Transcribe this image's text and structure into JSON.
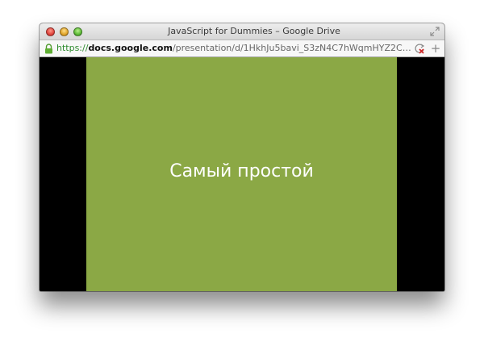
{
  "window": {
    "title": "JavaScript for Dummies – Google Drive"
  },
  "addressbar": {
    "url_scheme": "https://",
    "url_host": "docs.google.com",
    "url_path": "/presentation/d/1HkhJu5bavi_S3zN4C7hWqmHYZ2C…"
  },
  "slide": {
    "title": "Самый простой",
    "background_color": "#8ba845",
    "text_color": "#ffffff"
  },
  "icons": {
    "lock": "lock-icon",
    "reload": "reload-icon",
    "new_tab": "plus-icon",
    "fullscreen": "fullscreen-icon"
  },
  "new_tab_glyph": "+"
}
